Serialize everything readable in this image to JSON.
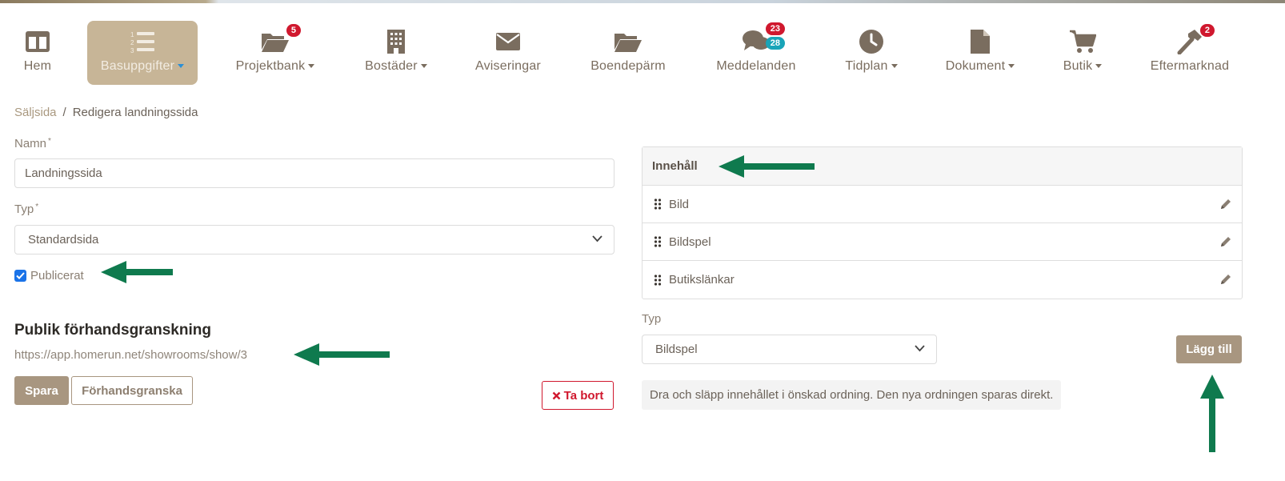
{
  "nav": {
    "items": [
      {
        "id": "hem",
        "label": "Hem",
        "icon": "home-grid-icon",
        "dropdown": false
      },
      {
        "id": "basuppgifter",
        "label": "Basuppgifter",
        "icon": "numbered-list-icon",
        "dropdown": true,
        "active": true
      },
      {
        "id": "projektbank",
        "label": "Projektbank",
        "icon": "folder-open-icon",
        "dropdown": true,
        "badge": "5"
      },
      {
        "id": "bostader",
        "label": "Bostäder",
        "icon": "building-icon",
        "dropdown": true
      },
      {
        "id": "aviseringar",
        "label": "Aviseringar",
        "icon": "envelope-icon",
        "dropdown": false
      },
      {
        "id": "boendeparm",
        "label": "Boendepärm",
        "icon": "folder-icon",
        "dropdown": false
      },
      {
        "id": "meddelanden",
        "label": "Meddelanden",
        "icon": "chat-bubbles-icon",
        "dropdown": false,
        "badge": "23",
        "badge2": "28"
      },
      {
        "id": "tidplan",
        "label": "Tidplan",
        "icon": "clock-icon",
        "dropdown": true
      },
      {
        "id": "dokument",
        "label": "Dokument",
        "icon": "file-icon",
        "dropdown": true
      },
      {
        "id": "butik",
        "label": "Butik",
        "icon": "cart-icon",
        "dropdown": true
      },
      {
        "id": "eftermarknad",
        "label": "Eftermarknad",
        "icon": "hammer-icon",
        "dropdown": false,
        "badge": "2"
      }
    ]
  },
  "breadcrumb": {
    "link": "Säljsida",
    "separator": "/",
    "current": "Redigera landningssida"
  },
  "form": {
    "name_label": "Namn",
    "name_value": "Landningssida",
    "type_label": "Typ",
    "type_value": "Standardsida",
    "required_mark": "*",
    "published_label": "Publicerat",
    "published": true,
    "preview_title": "Publik förhandsgranskning",
    "preview_url": "https://app.homerun.net/showrooms/show/3",
    "save_label": "Spara",
    "preview_label": "Förhandsgranska",
    "delete_label": "Ta bort"
  },
  "content": {
    "header": "Innehåll",
    "items": [
      "Bild",
      "Bildspel",
      "Butikslänkar"
    ],
    "type_label": "Typ",
    "type_value": "Bildspel",
    "add_label": "Lägg till",
    "hint": "Dra och släpp innehållet i önskad ordning. Den nya ordningen sparas direkt."
  },
  "colors": {
    "accent": "#a89680",
    "active_nav": "#c7b597",
    "danger": "#d0182e",
    "annotation_arrow": "#0f7a4e",
    "badge_red": "#d0182e",
    "badge_teal": "#19a4b8"
  }
}
